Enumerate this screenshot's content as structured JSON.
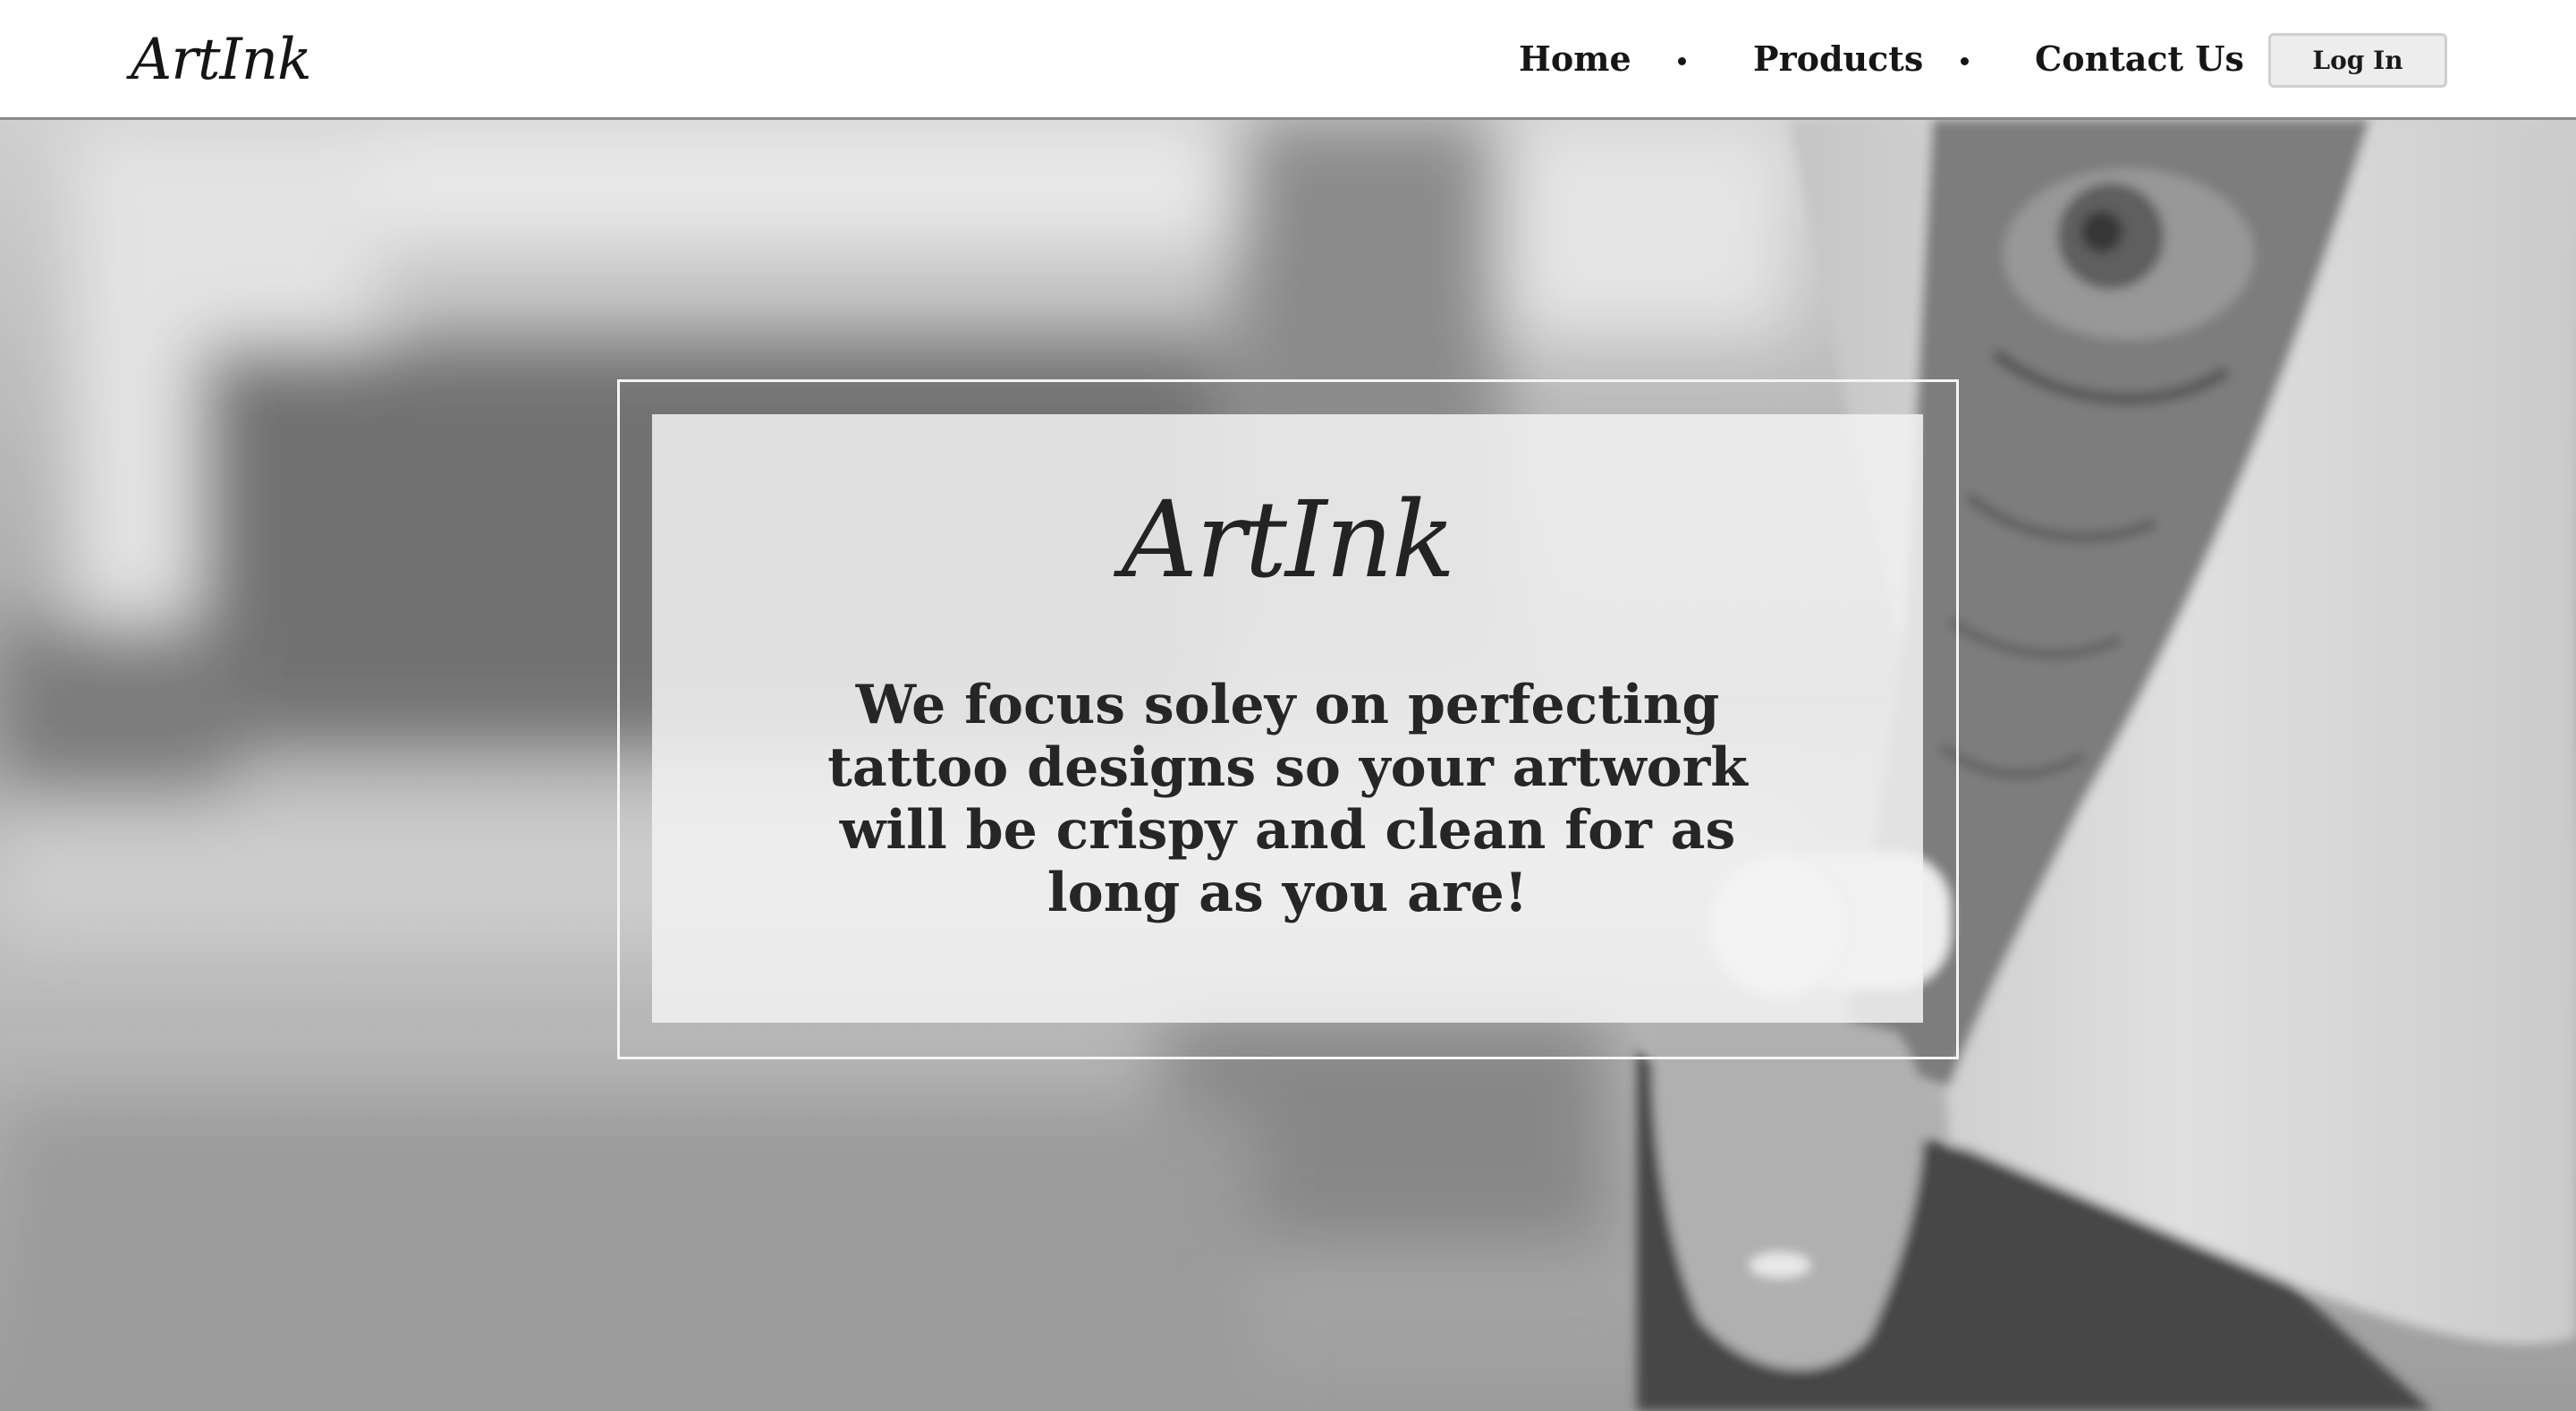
{
  "header": {
    "logo": "ArtInk",
    "nav": {
      "home": "Home",
      "products": "Products",
      "contact": "Contact Us"
    },
    "login_label": "Log In"
  },
  "hero": {
    "title": "ArtInk",
    "tagline": "We focus soley on perfecting tattoo designs so your artwork will be crispy and clean for as long as you are!"
  },
  "colors": {
    "header_bg": "#ffffff",
    "text_dark": "#161616",
    "card_bg": "#f2f2f2",
    "frame_border": "#f4f4f4"
  }
}
